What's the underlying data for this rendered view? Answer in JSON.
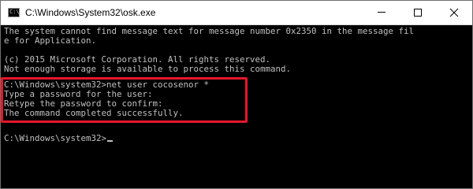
{
  "window": {
    "title": "C:\\Windows\\System32\\osk.exe",
    "icon": "console-app-icon",
    "icon_glyph": "C:\\_"
  },
  "controls": {
    "minimize": "minimize-icon",
    "maximize": "maximize-icon",
    "close": "close-icon"
  },
  "console": {
    "lines": [
      "The system cannot find message text for message number 0x2350 in the message fil",
      "e for Application.",
      "",
      "(c) 2015 Microsoft Corporation. All rights reserved.",
      "Not enough storage is available to process this command.",
      "",
      "C:\\Windows\\system32>net user cocosenor *",
      "Type a password for the user:",
      "Retype the password to confirm:",
      "The command completed successfully.",
      "",
      "",
      "C:\\Windows\\system32>"
    ],
    "text_color": "#c0c0c0",
    "background": "#000000"
  },
  "annotation": {
    "highlight_color": "#e5172b"
  }
}
